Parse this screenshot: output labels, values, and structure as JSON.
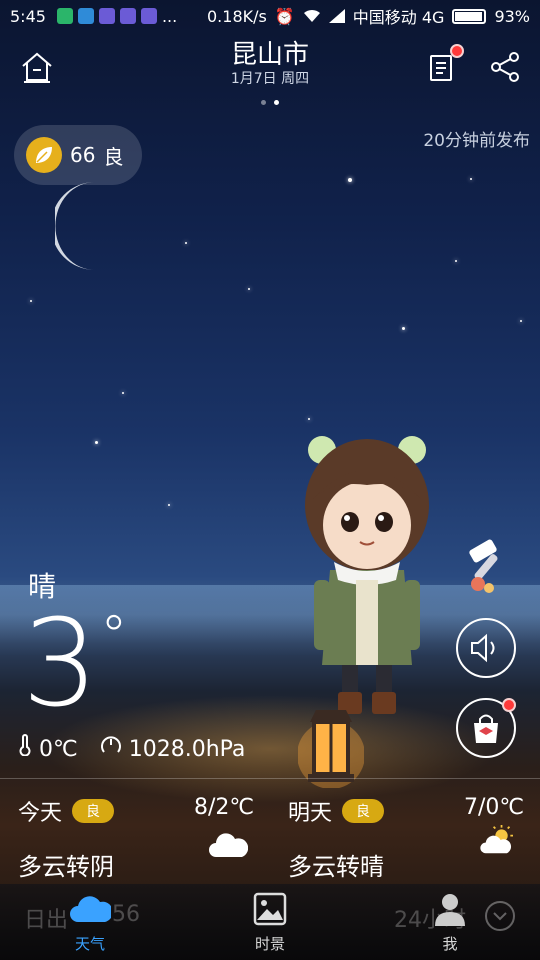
{
  "status_bar": {
    "time": "5:45",
    "more": "...",
    "speed": "0.18K/s",
    "carrier": "中国移动 4G",
    "battery": "93%"
  },
  "header": {
    "city": "昆山市",
    "date": "1月7日 周四"
  },
  "aqi": {
    "value": "66",
    "level": "良"
  },
  "publish_time": "20分钟前发布",
  "current": {
    "condition": "晴",
    "temperature": "3",
    "degree_symbol": "°",
    "feels_like": "0℃",
    "pressure": "1028.0hPa"
  },
  "forecast": [
    {
      "day": "今天",
      "aqi_level": "良",
      "range": "8/2℃",
      "desc": "多云转阴",
      "icon": "cloud-icon"
    },
    {
      "day": "明天",
      "aqi_level": "良",
      "range": "7/0℃",
      "desc": "多云转晴",
      "icon": "partly-sunny-icon"
    }
  ],
  "bottom_hints": {
    "sunrise": "日出",
    "sunrise_time": "56",
    "hourly": "24小时"
  },
  "nav": [
    {
      "label": "天气",
      "icon": "cloud-icon",
      "active": true
    },
    {
      "label": "时景",
      "icon": "picture-icon",
      "active": false
    },
    {
      "label": "我",
      "icon": "person-icon",
      "active": false
    }
  ],
  "colors": {
    "accent": "#3aa2ff",
    "aqi_badge": "#d7a912",
    "notification": "#ff3a3a"
  }
}
